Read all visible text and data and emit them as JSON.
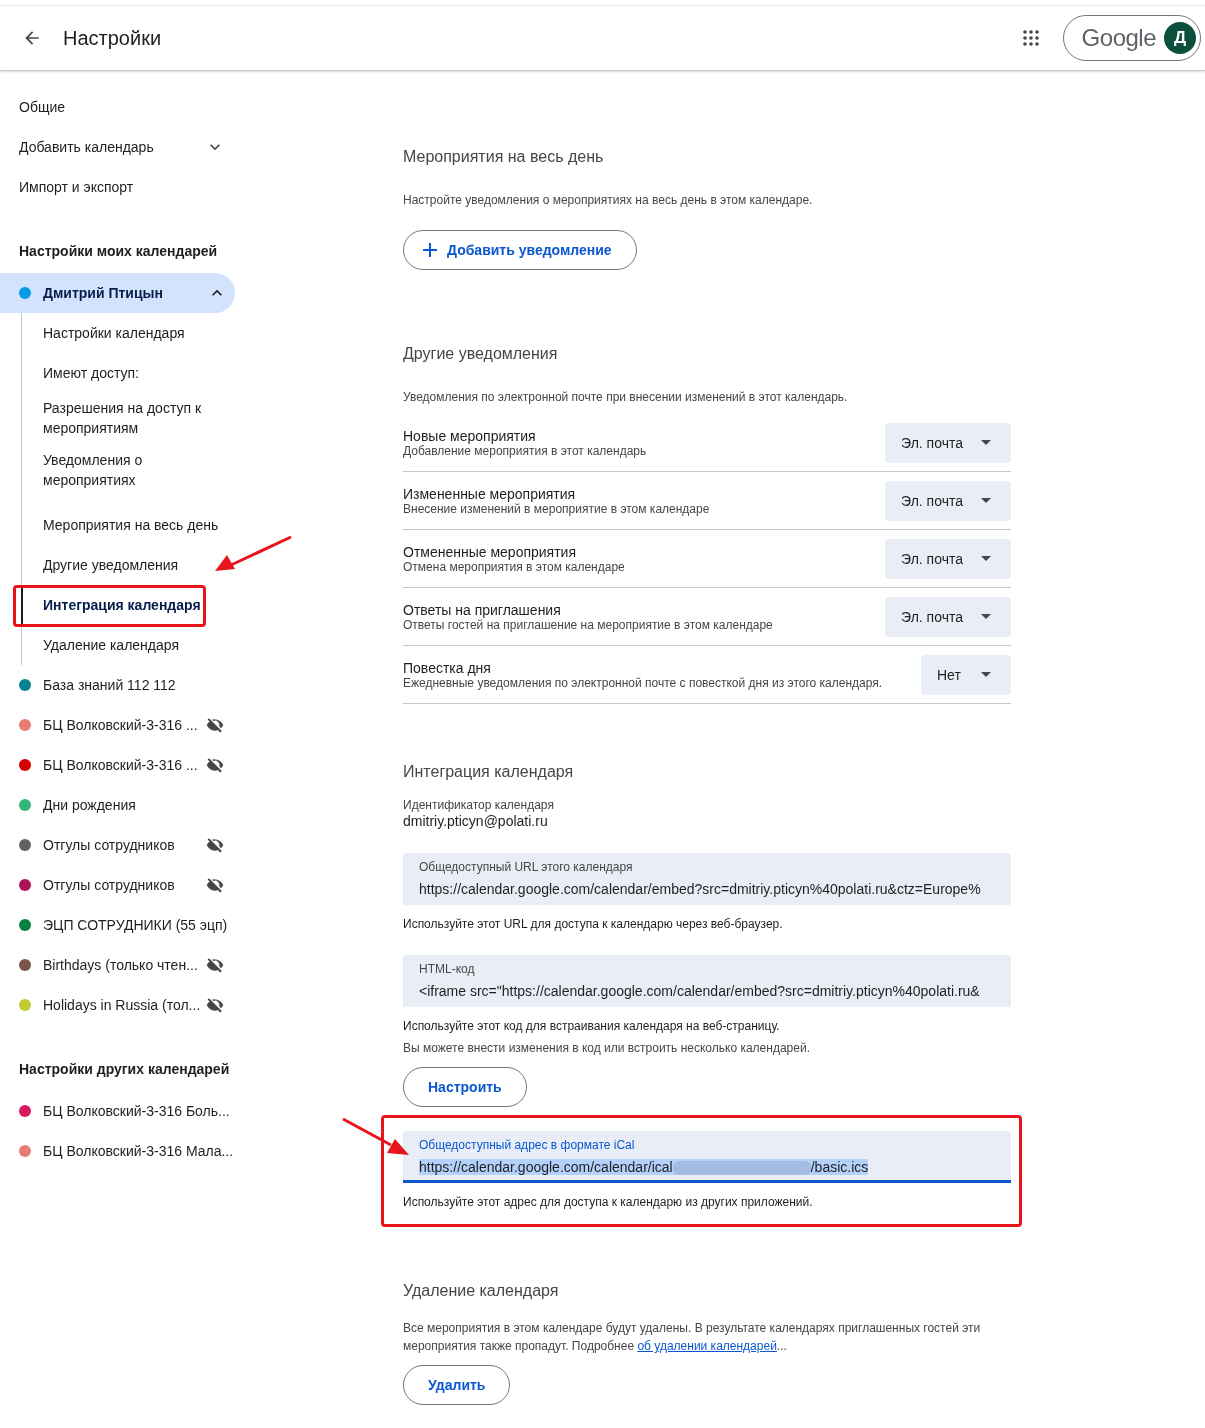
{
  "header": {
    "title": "Настройки",
    "logo": "Google",
    "avatar": "Д"
  },
  "sidebar": {
    "top_items": [
      {
        "label": "Общие",
        "kind": "link"
      },
      {
        "label": "Добавить календарь",
        "kind": "dropdown"
      },
      {
        "label": "Импорт и экспорт",
        "kind": "link"
      }
    ],
    "my_calendars": {
      "heading": "Настройки моих календарей",
      "calendars": [
        {
          "label": "Дмитрий Птицын",
          "color": "#039be5",
          "hidden": false,
          "expanded": true,
          "selected": true,
          "children": [
            {
              "label": "Настройки календаря",
              "selected": false,
              "highlighted": false
            },
            {
              "label": "Имеют доступ:",
              "selected": false,
              "highlighted": false
            },
            {
              "label": "Разрешения на доступ к мероприятиям",
              "selected": false,
              "highlighted": false
            },
            {
              "label": "Уведомления о мероприятиях",
              "selected": false,
              "highlighted": false
            },
            {
              "label": "Мероприятия на весь день",
              "selected": false,
              "highlighted": false
            },
            {
              "label": "Другие уведомления",
              "selected": false,
              "highlighted": false
            },
            {
              "label": "Интеграция календаря",
              "selected": true,
              "highlighted": true
            },
            {
              "label": "Удаление календаря",
              "selected": false,
              "highlighted": false
            }
          ]
        },
        {
          "label": "База знаний 112 112",
          "color": "#03838f",
          "hidden": false,
          "selected": false
        },
        {
          "label": "БЦ Волковский-3-316 ...",
          "color": "#e67c73",
          "hidden": true,
          "selected": false
        },
        {
          "label": "БЦ Волковский-3-316 ...",
          "color": "#d50000",
          "hidden": true,
          "selected": false
        },
        {
          "label": "Дни рождения",
          "color": "#33b679",
          "hidden": false,
          "selected": false
        },
        {
          "label": "Отгулы сотрудников",
          "color": "#616161",
          "hidden": true,
          "selected": false
        },
        {
          "label": "Отгулы сотрудников",
          "color": "#ad1457",
          "hidden": true,
          "selected": false
        },
        {
          "label": "ЭЦП СОТРУДНИКИ (55 эцп)",
          "color": "#0b8043",
          "hidden": false,
          "selected": false
        },
        {
          "label": "Birthdays (только чтен...",
          "color": "#795548",
          "hidden": true,
          "selected": false
        },
        {
          "label": "Holidays in Russia (тол...",
          "color": "#c0ca33",
          "hidden": true,
          "selected": false
        }
      ]
    },
    "other_calendars": {
      "heading": "Настройки других календарей",
      "calendars": [
        {
          "label": "БЦ Волковский-3-316 Боль...",
          "color": "#d81b60",
          "hidden": false,
          "selected": false
        },
        {
          "label": "БЦ Волковский-3-316 Мала...",
          "color": "#e67c73",
          "hidden": false,
          "selected": false
        }
      ]
    }
  },
  "all_day": {
    "title": "Мероприятия на весь день",
    "description": "Настройте уведомления о мероприятиях на весь день в этом календаре.",
    "button": "Добавить уведомление"
  },
  "other_notifications": {
    "title": "Другие уведомления",
    "description": "Уведомления по электронной почте при внесении изменений в этот календарь.",
    "rows": [
      {
        "title": "Новые мероприятия",
        "subtitle": "Добавление мероприятия в этот календарь",
        "value": "Эл. почта"
      },
      {
        "title": "Измененные мероприятия",
        "subtitle": "Внесение изменений в мероприятие в этом календаре",
        "value": "Эл. почта"
      },
      {
        "title": "Отмененные мероприятия",
        "subtitle": "Отмена мероприятия в этом календаре",
        "value": "Эл. почта"
      },
      {
        "title": "Ответы на приглашения",
        "subtitle": "Ответы гостей на приглашение на мероприятие в этом календаре",
        "value": "Эл. почта"
      },
      {
        "title": "Повестка дня",
        "subtitle": "Ежедневные уведомления по электронной почте с повесткой дня из этого календаря.",
        "value": "Нет"
      }
    ]
  },
  "integration": {
    "title": "Интеграция календаря",
    "id_label": "Идентификатор календаря",
    "id_value": "dmitriy.pticyn@polati.ru",
    "public_url": {
      "label": "Общедоступный URL этого календаря",
      "value": "https://calendar.google.com/calendar/embed?src=dmitriy.pticyn%40polati.ru&ctz=Europe%",
      "help": "Используйте этот URL для доступа к календарю через веб-браузер."
    },
    "html_code": {
      "label": "HTML-код",
      "value": "<iframe src=\"https://calendar.google.com/calendar/embed?src=dmitriy.pticyn%40polati.ru&",
      "help": "Используйте этот код для встраивания календаря на веб-страницу.",
      "help_2": "Вы можете внести изменения в код или встроить несколько календарей."
    },
    "customize_button": "Настроить",
    "ical": {
      "label": "Общедоступный адрес в формате iCal",
      "value_start": "https://calendar.google.com/calendar/ical",
      "value_end": "/basic.ics",
      "focused": true,
      "highlighted": true,
      "help": "Используйте этот адрес для доступа к календарю из других приложений."
    }
  },
  "delete": {
    "title": "Удаление календаря",
    "description": "Все мероприятия в этом календаре будут удалены. В результате календарях приглашенных гостей эти мероприятия также пропадут. Подробнее ",
    "link": "об удалении календарей",
    "after_link": "...",
    "button": "Удалить"
  }
}
